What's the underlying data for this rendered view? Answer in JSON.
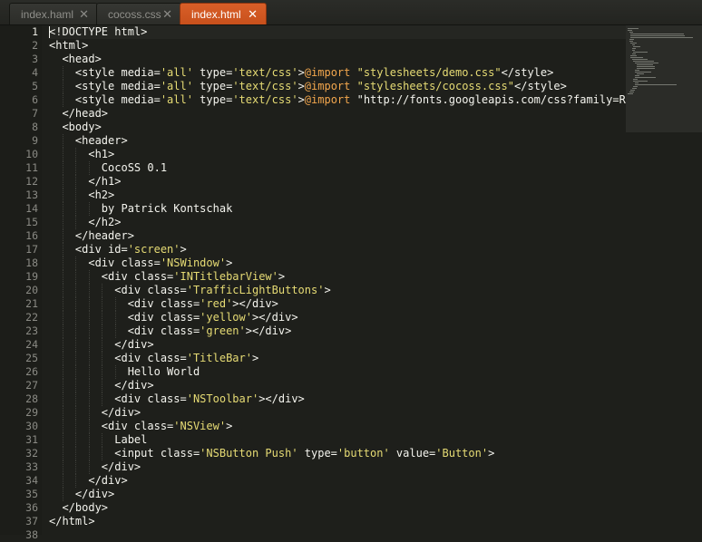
{
  "tabs": [
    {
      "label": "index.haml",
      "active": false
    },
    {
      "label": "cocoss.css",
      "active": false
    },
    {
      "label": "index.html",
      "active": true
    }
  ],
  "close_glyph": "✕",
  "current_line": 1,
  "code_lines": [
    "<!DOCTYPE html>",
    "<html>",
    "  <head>",
    "    <style media='all' type='text/css'>@import \"stylesheets/demo.css\"</style>",
    "    <style media='all' type='text/css'>@import \"stylesheets/cocoss.css\"</style>",
    "    <style media='all' type='text/css'>@import \"http://fonts.googleapis.com/css?family=Roc",
    "  </head>",
    "  <body>",
    "    <header>",
    "      <h1>",
    "        CocoSS 0.1",
    "      </h1>",
    "      <h2>",
    "        by Patrick Kontschak",
    "      </h2>",
    "    </header>",
    "    <div id='screen'>",
    "      <div class='NSWindow'>",
    "        <div class='INTitlebarView'>",
    "          <div class='TrafficLightButtons'>",
    "            <div class='red'></div>",
    "            <div class='yellow'></div>",
    "            <div class='green'></div>",
    "          </div>",
    "          <div class='TitleBar'>",
    "            Hello World",
    "          </div>",
    "          <div class='NSToolbar'></div>",
    "        </div>",
    "        <div class='NSView'>",
    "          Label",
    "          <input class='NSButton Push' type='button' value='Button'>",
    "        </div>",
    "      </div>",
    "    </div>",
    "  </body>",
    "</html>",
    ""
  ],
  "line_numbers": [
    "1",
    "2",
    "3",
    "4",
    "5",
    "6",
    "7",
    "8",
    "9",
    "10",
    "11",
    "12",
    "13",
    "14",
    "15",
    "16",
    "17",
    "18",
    "19",
    "20",
    "21",
    "22",
    "23",
    "24",
    "25",
    "26",
    "27",
    "28",
    "29",
    "30",
    "31",
    "32",
    "33",
    "34",
    "35",
    "36",
    "37",
    "38"
  ],
  "colors": {
    "background": "#1e1f1b",
    "text": "#f4f4ee",
    "string": "#e6db74",
    "at_rule": "#f2a64d",
    "active_tab": "#d95f28"
  },
  "icons": {
    "tab_close": "close-icon"
  }
}
